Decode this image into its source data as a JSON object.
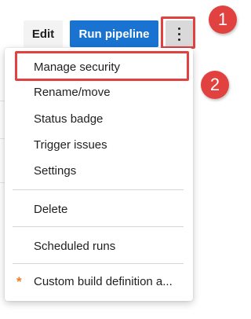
{
  "toolbar": {
    "edit_label": "Edit",
    "run_label": "Run pipeline",
    "more_icon": "vertical-ellipsis-icon"
  },
  "menu": {
    "items": [
      {
        "label": "Manage security"
      },
      {
        "label": "Rename/move"
      },
      {
        "label": "Status badge"
      },
      {
        "label": "Trigger issues"
      },
      {
        "label": "Settings"
      },
      {
        "label": "Delete"
      },
      {
        "label": "Scheduled runs"
      },
      {
        "label": "Custom build definition a...",
        "icon": "star-icon"
      }
    ]
  },
  "annotations": {
    "badge_1": "1",
    "badge_2": "2",
    "color": "#e2423f"
  },
  "colors": {
    "primary": "#1a73d1",
    "star": "#f07d28"
  }
}
